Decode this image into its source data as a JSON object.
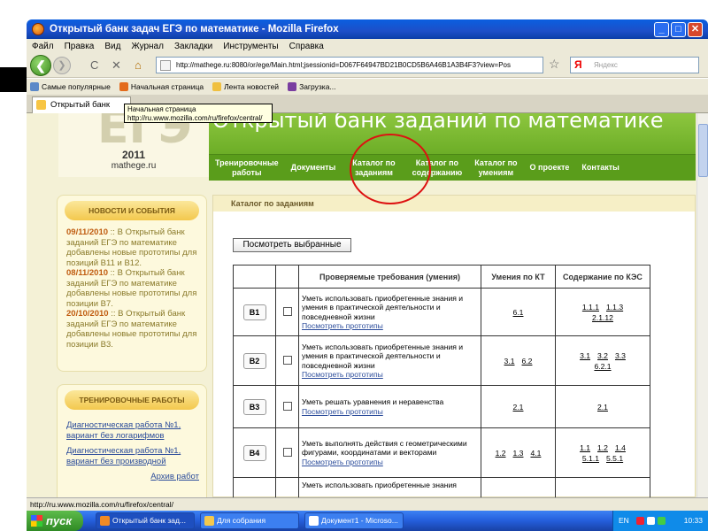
{
  "window": {
    "title": "Открытый банк задач ЕГЭ по математике - Mozilla Firefox",
    "min_glyph": "_",
    "max_glyph": "□",
    "close_glyph": "✕"
  },
  "menu": [
    "Файл",
    "Правка",
    "Вид",
    "Журнал",
    "Закладки",
    "Инструменты",
    "Справка"
  ],
  "toolbar": {
    "back_glyph": "❮",
    "forward_glyph": "❯",
    "url": "http://mathege.ru:8080/or/ege/Main.html;jsessionid=D067F64947BD21B0CD5B6A46B1A3B4F3?view=Pos",
    "search_engine": "Я",
    "search_placeholder": "Яндекс",
    "star_glyph": "☆",
    "stop_glyph": "✕",
    "home_glyph": "⌂",
    "reload_glyph": "C"
  },
  "bookmarks": [
    "Самые популярные",
    "Начальная страница",
    "Лента новостей",
    "Загрузка..."
  ],
  "tab": {
    "title": "Открытый банк зад..."
  },
  "tooltip": {
    "line1": "Начальная страница",
    "line2": "http://ru.www.mozilla.com/ru/firefox/central/"
  },
  "site": {
    "logo": "ЕГЭ",
    "year": "2011",
    "domain": "mathege.ru",
    "title": "Открытый банк заданий по математике"
  },
  "nav": [
    {
      "line1": "Тренировочные",
      "line2": "работы"
    },
    {
      "line1": "Документы",
      "line2": ""
    },
    {
      "line1": "Каталог по",
      "line2": "заданиям"
    },
    {
      "line1": "Каталог по",
      "line2": "содержанию"
    },
    {
      "line1": "Каталог по",
      "line2": "умениям"
    },
    {
      "line1": "О проекте",
      "line2": ""
    },
    {
      "line1": "Контакты",
      "line2": ""
    }
  ],
  "news": {
    "header": "НОВОСТИ И СОБЫТИЯ",
    "items": [
      {
        "date": "09/11/2010",
        "text": ":: В Открытый банк заданий ЕГЭ по математике добавлены новые прототипы для позиций В11 и В12."
      },
      {
        "date": "08/11/2010",
        "text": ":: В Открытый банк заданий ЕГЭ по математике добавлены новые прототипы для позиции В7."
      },
      {
        "date": "20/10/2010",
        "text": ":: В Открытый банк заданий ЕГЭ по математике добавлены новые прототипы для позиции В3."
      }
    ]
  },
  "training": {
    "header": "ТРЕНИРОВОЧНЫЕ РАБОТЫ",
    "links": [
      "Диагностическая работа №1, вариант без логарифмов",
      "Диагностическая работа №1, вариант без производной"
    ],
    "archive": "Архив работ"
  },
  "catalog": {
    "header": "Каталог по заданиям",
    "show_selected": "Посмотреть выбранные",
    "columns": [
      "Проверяемые требования (умения)",
      "Умения по КТ",
      "Содержание по КЭС"
    ],
    "rows": [
      {
        "code": "B1",
        "req": "Уметь использовать приобретенные знания и умения в практической деятельности и повседневной жизни",
        "proto": "Посмотреть прототипы",
        "kt": [
          "6.1"
        ],
        "kes1": [
          "1.1.1",
          "1.1.3"
        ],
        "kes2": [
          "2.1.12"
        ]
      },
      {
        "code": "B2",
        "req": "Уметь использовать приобретенные знания и умения в практической деятельности и повседневной жизни",
        "proto": "Посмотреть прототипы",
        "kt": [
          "3.1",
          "6.2"
        ],
        "kes1": [
          "3.1",
          "3.2",
          "3.3"
        ],
        "kes2": [
          "6.2.1"
        ]
      },
      {
        "code": "B3",
        "req": "Уметь решать уравнения и неравенства",
        "proto": "Посмотреть прототипы",
        "kt": [
          "2.1"
        ],
        "kes1": [
          "2.1"
        ],
        "kes2": []
      },
      {
        "code": "B4",
        "req": "Уметь выполнять действия с геометрическими фигурами, координатами и векторами",
        "proto": "Посмотреть прототипы",
        "kt": [
          "1.2",
          "1.3",
          "4.1"
        ],
        "kes1": [
          "1.1",
          "1.2",
          "1.4"
        ],
        "kes2": [
          "5.1.1",
          "5.5.1"
        ]
      },
      {
        "code": "",
        "req": "Уметь использовать приобретенные знания",
        "proto": "",
        "kt": [],
        "kes1": [],
        "kes2": []
      }
    ]
  },
  "status": {
    "text": "http://ru.www.mozilla.com/ru/firefox/central/"
  },
  "taskbar": {
    "start": "пуск",
    "buttons": [
      "Открытый банк зад...",
      "Для собрания",
      "Документ1 - Microso..."
    ],
    "lang": "EN",
    "time": "10:33"
  }
}
